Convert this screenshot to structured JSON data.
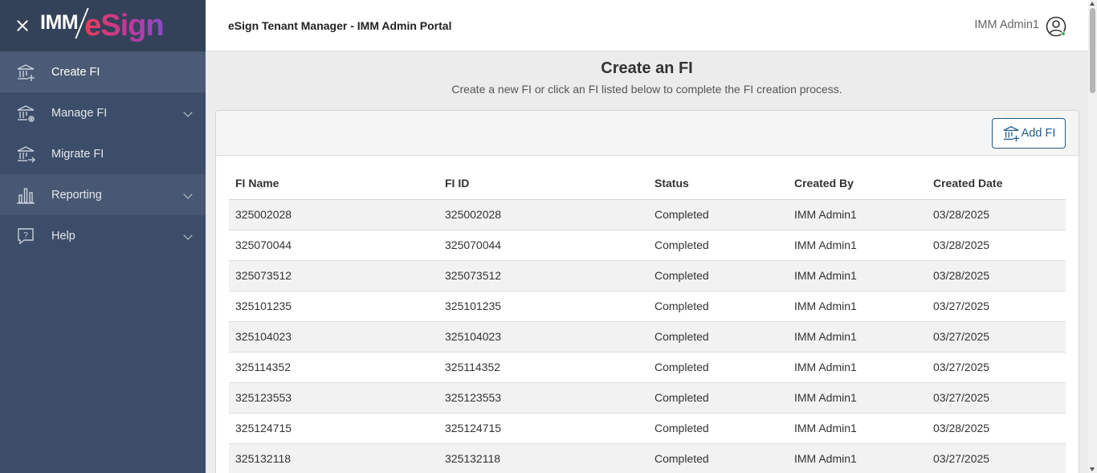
{
  "sidebar": {
    "logo": {
      "part1": "IMM",
      "part2": "eSign"
    },
    "items": [
      {
        "label": "Create FI",
        "icon": "bank-add-icon",
        "active": true,
        "expandable": false
      },
      {
        "label": "Manage FI",
        "icon": "bank-settings-icon",
        "active": false,
        "expandable": true
      },
      {
        "label": "Migrate FI",
        "icon": "bank-arrow-icon",
        "active": false,
        "expandable": false
      },
      {
        "label": "Reporting",
        "icon": "bar-chart-icon",
        "active": false,
        "expandable": true
      },
      {
        "label": "Help",
        "icon": "help-icon",
        "active": false,
        "expandable": true
      }
    ]
  },
  "header": {
    "title": "eSign Tenant Manager - IMM Admin Portal",
    "user_name": "IMM Admin1"
  },
  "main": {
    "title": "Create an FI",
    "subtitle": "Create a new FI or click an FI listed below to complete the FI creation process.",
    "add_button_label": "Add FI",
    "table": {
      "columns": [
        "FI Name",
        "FI ID",
        "Status",
        "Created By",
        "Created Date"
      ],
      "rows": [
        [
          "325002028",
          "325002028",
          "Completed",
          "IMM Admin1",
          "03/28/2025"
        ],
        [
          "325070044",
          "325070044",
          "Completed",
          "IMM Admin1",
          "03/28/2025"
        ],
        [
          "325073512",
          "325073512",
          "Completed",
          "IMM Admin1",
          "03/28/2025"
        ],
        [
          "325101235",
          "325101235",
          "Completed",
          "IMM Admin1",
          "03/27/2025"
        ],
        [
          "325104023",
          "325104023",
          "Completed",
          "IMM Admin1",
          "03/27/2025"
        ],
        [
          "325114352",
          "325114352",
          "Completed",
          "IMM Admin1",
          "03/27/2025"
        ],
        [
          "325123553",
          "325123553",
          "Completed",
          "IMM Admin1",
          "03/27/2025"
        ],
        [
          "325124715",
          "325124715",
          "Completed",
          "IMM Admin1",
          "03/28/2025"
        ],
        [
          "325132118",
          "325132118",
          "Completed",
          "IMM Admin1",
          "03/27/2025"
        ]
      ]
    }
  },
  "colors": {
    "sidebar_bg": "#3c4d69",
    "sidebar_active": "#4b5b76",
    "accent": "#1f5d8c",
    "brand_gradient_start": "#e83c5b",
    "brand_gradient_end": "#8a4bc9"
  }
}
